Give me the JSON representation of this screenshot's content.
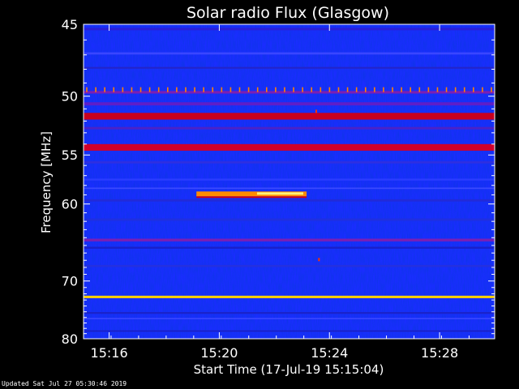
{
  "chart_data": {
    "type": "heatmap",
    "title": "Solar radio Flux (Glasgow)",
    "xlabel": "Start Time (17-Jul-19 15:15:04)",
    "ylabel": "Frequency [MHz]",
    "x_ticks": [
      "15:16",
      "15:20",
      "15:24",
      "15:28"
    ],
    "x_tick_minutes": [
      0.93,
      4.93,
      8.93,
      12.93
    ],
    "x_range_minutes": [
      0,
      14.93
    ],
    "y_ticks": [
      45,
      50,
      55,
      60,
      70,
      80
    ],
    "ylim": [
      45,
      80
    ],
    "y_scale": "reciprocal",
    "background_color": "#1a2dff",
    "bands": [
      {
        "freq": 45.3,
        "width": 0.15,
        "color": "#2b1fd6"
      },
      {
        "freq": 46.9,
        "width": 0.15,
        "color": "#3a46ff"
      },
      {
        "freq": 47.9,
        "width": 0.12,
        "color": "#2424c8"
      },
      {
        "freq": 49.7,
        "width": 0.2,
        "color": "#7a1fb5"
      },
      {
        "freq": 50.6,
        "width": 0.25,
        "color": "#5e1ec8"
      },
      {
        "freq": 51.6,
        "width": 0.55,
        "color": "#c8001e"
      },
      {
        "freq": 52.6,
        "width": 0.2,
        "color": "#4b22c8"
      },
      {
        "freq": 54.3,
        "width": 0.6,
        "color": "#d0002a"
      },
      {
        "freq": 55.7,
        "width": 0.2,
        "color": "#2f2fe0"
      },
      {
        "freq": 57.4,
        "width": 0.2,
        "color": "#2a3cff"
      },
      {
        "freq": 58.3,
        "width": 0.15,
        "color": "#3a49ff"
      },
      {
        "freq": 59.6,
        "width": 0.25,
        "color": "#222ad8"
      },
      {
        "freq": 61.8,
        "width": 0.3,
        "color": "#2030e0"
      },
      {
        "freq": 64.3,
        "width": 0.35,
        "color": "#7a1fb5"
      },
      {
        "freq": 65.3,
        "width": 0.25,
        "color": "#1b1fc8"
      },
      {
        "freq": 67.8,
        "width": 0.3,
        "color": "#2430e0"
      },
      {
        "freq": 72.5,
        "width": 0.4,
        "color": "#ffd000"
      },
      {
        "freq": 75.2,
        "width": 0.3,
        "color": "#1b22c8"
      },
      {
        "freq": 76.2,
        "width": 0.25,
        "color": "#3a46ff"
      },
      {
        "freq": 78.5,
        "width": 0.25,
        "color": "#1b1fc0"
      }
    ],
    "events": [
      {
        "type": "burst",
        "t_start": 4.1,
        "t_end": 8.1,
        "freq": 58.9,
        "color": "#ff8c00"
      },
      {
        "type": "spike",
        "t": 8.55,
        "freq": 66.9,
        "color": "#ff3000"
      },
      {
        "type": "spike",
        "t": 8.45,
        "freq": 51.2,
        "color": "#ff3000"
      }
    ],
    "periodic_markers": {
      "freq": 49.5,
      "color": "#ff8000",
      "count": 46
    }
  },
  "footer": "Updated Sat Jul 27 05:30:46 2019"
}
